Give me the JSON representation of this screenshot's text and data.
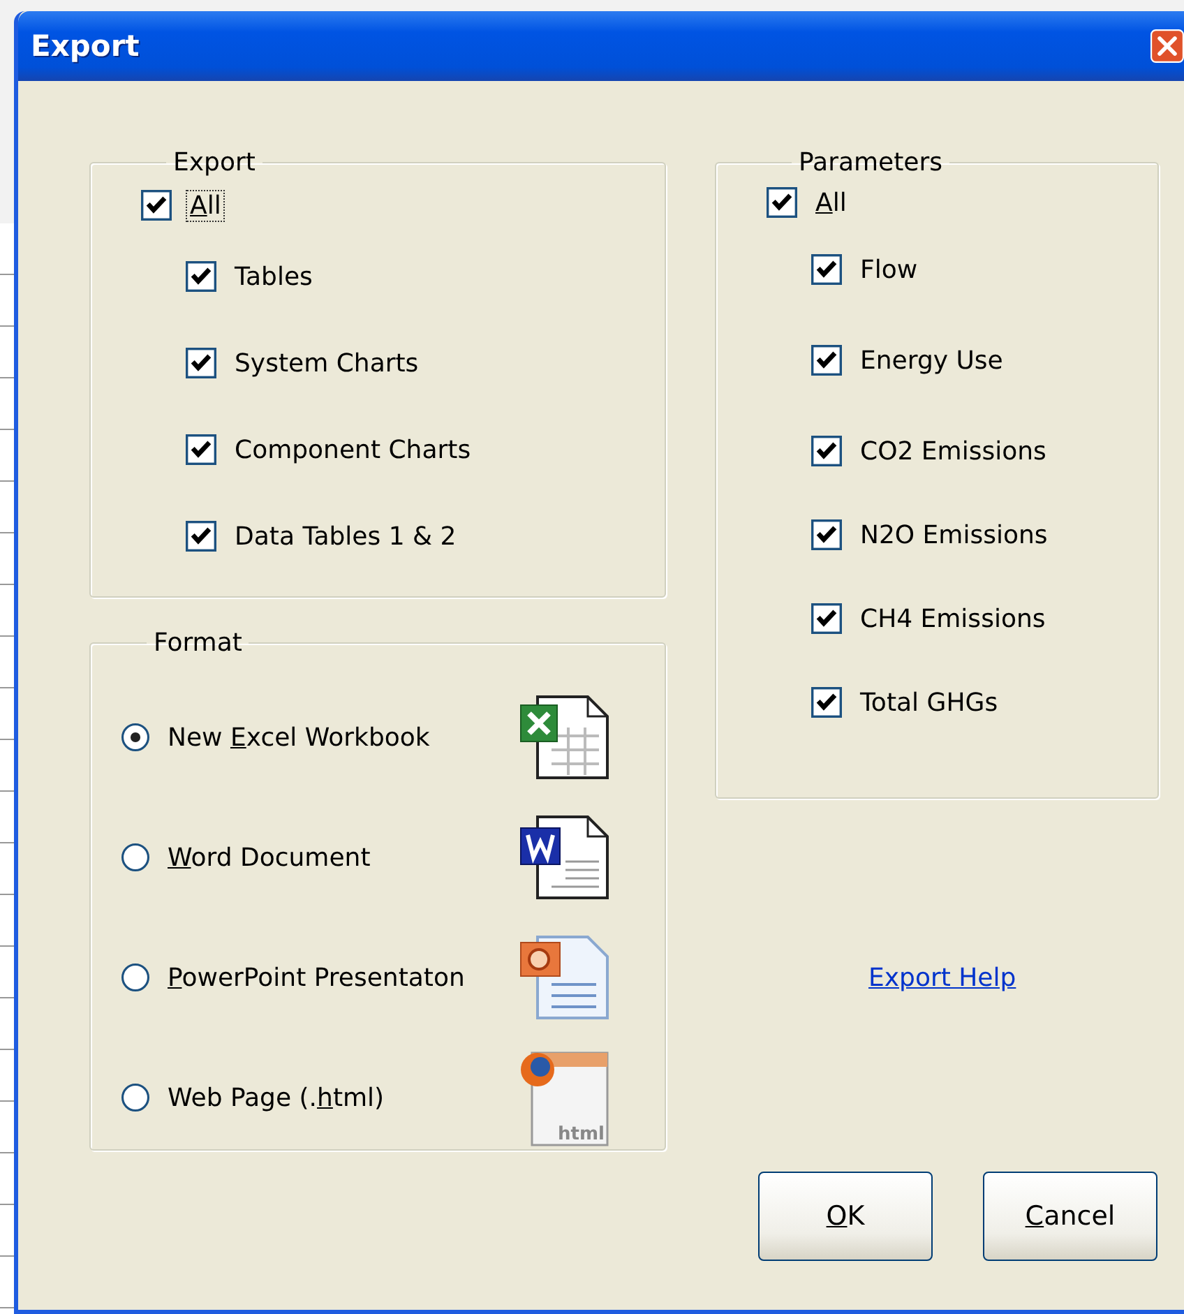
{
  "window": {
    "title": "Export"
  },
  "export_group": {
    "title": "Export",
    "all": {
      "label": {
        "key": "A",
        "after": "ll"
      },
      "checked": true,
      "focused": true
    },
    "items": [
      {
        "label": "Tables",
        "checked": true
      },
      {
        "label": "System Charts",
        "checked": true
      },
      {
        "label": "Component Charts",
        "checked": true
      },
      {
        "label": "Data Tables 1 & 2",
        "checked": true
      }
    ]
  },
  "format_group": {
    "title": "Format",
    "options": [
      {
        "kind": "excel",
        "label": {
          "before": "New ",
          "key": "E",
          "after": "xcel Workbook"
        },
        "selected": true
      },
      {
        "kind": "word",
        "label": {
          "key": "W",
          "after": "ord Document"
        },
        "selected": false
      },
      {
        "kind": "powerpoint",
        "label": {
          "key": "P",
          "after": "owerPoint Presentaton"
        },
        "selected": false
      },
      {
        "kind": "html",
        "label": {
          "before": "Web Page (.",
          "key": "h",
          "after": "tml)"
        },
        "selected": false,
        "icon_caption": "html"
      }
    ]
  },
  "parameters_group": {
    "title": "Parameters",
    "all": {
      "label": {
        "key": "A",
        "after": "ll"
      },
      "checked": true,
      "focused": false
    },
    "items": [
      {
        "label": "Flow",
        "checked": true
      },
      {
        "label": "Energy Use",
        "checked": true
      },
      {
        "label": "CO2 Emissions",
        "checked": true
      },
      {
        "label": "N2O Emissions",
        "checked": true
      },
      {
        "label": "CH4 Emissions",
        "checked": true
      },
      {
        "label": "Total GHGs",
        "checked": true
      }
    ]
  },
  "help_link": "Export Help",
  "buttons": [
    {
      "label": {
        "key": "O",
        "after": "K"
      }
    },
    {
      "label": {
        "key": "C",
        "after": "ancel"
      }
    }
  ]
}
